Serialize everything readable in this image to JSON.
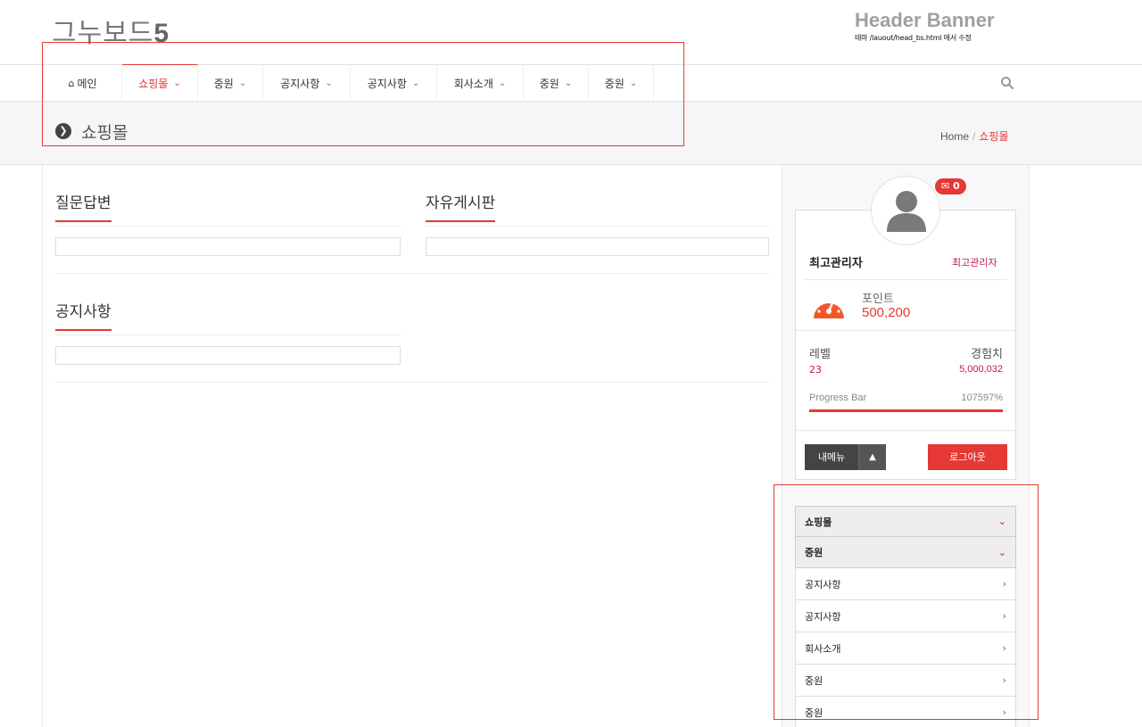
{
  "header": {
    "logo_text": "그누보드",
    "logo_num": "5",
    "banner_title": "Header Banner",
    "banner_sub": "테마 /lauout/head_bs.html 에서 수정"
  },
  "nav": {
    "home": "메인",
    "items": [
      "쇼핑몰",
      "중원",
      "공지사항",
      "공지사항",
      "회사소개",
      "중원",
      "중원"
    ]
  },
  "subheader": {
    "title": "쇼핑몰",
    "crumb_home": "Home",
    "crumb_sep": "/",
    "crumb_current": "쇼핑몰"
  },
  "boards": {
    "b1": "질문답변",
    "b2": "자유게시판",
    "b3": "공지사항"
  },
  "profile": {
    "badge": "0",
    "name": "최고관리자",
    "role": "최고관리자",
    "point_label": "포인트",
    "point_value": "500,200",
    "level_label": "레벨",
    "level_value": "23",
    "exp_label": "경험치",
    "exp_value": "5,000,032",
    "progress_label": "Progress Bar",
    "progress_value": "107597%",
    "progress_fill": 1.0,
    "mymenu": "내메뉴",
    "logout": "로그아웃"
  },
  "side_menu": {
    "items": [
      "쇼핑몰",
      "중원",
      "공지사항",
      "공지사항",
      "회사소개",
      "중원",
      "중원"
    ]
  },
  "colors": {
    "accent": "#e53935",
    "gauge": "#f0582a"
  }
}
